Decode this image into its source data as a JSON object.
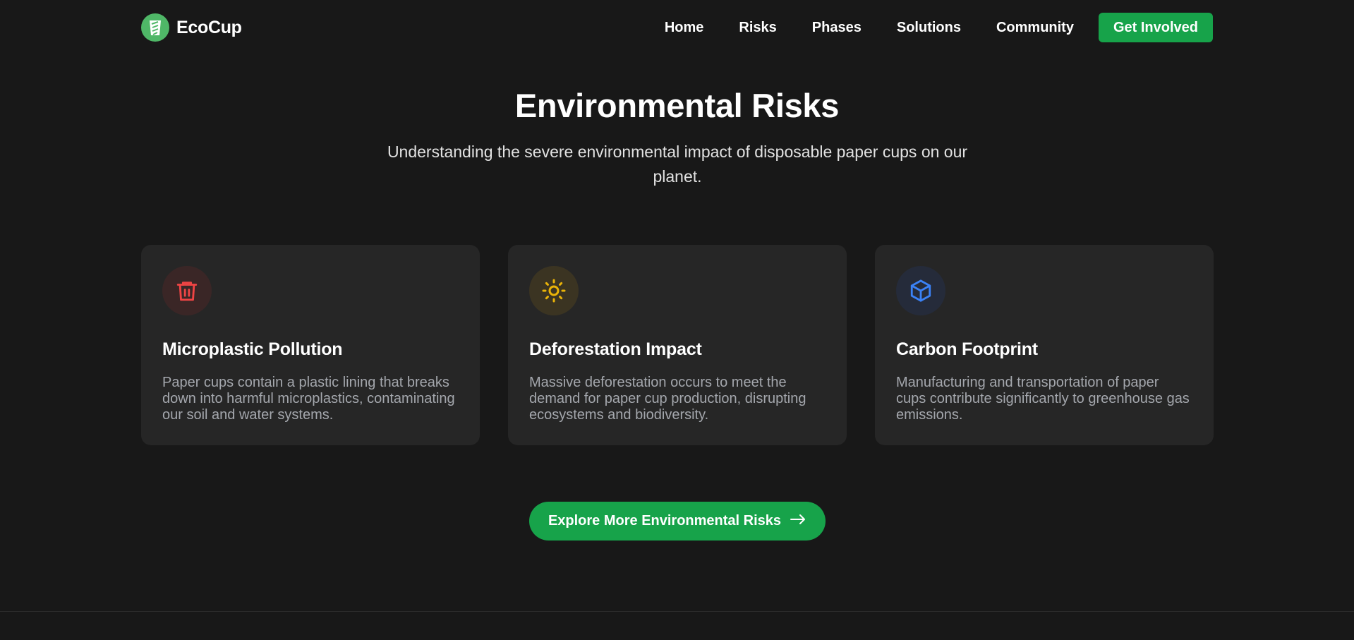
{
  "brand": {
    "name": "EcoCup",
    "logo_icon": "cup-icon"
  },
  "nav": {
    "items": [
      {
        "label": "Home"
      },
      {
        "label": "Risks"
      },
      {
        "label": "Phases"
      },
      {
        "label": "Solutions"
      },
      {
        "label": "Community"
      }
    ],
    "cta_label": "Get Involved"
  },
  "hero": {
    "title": "Environmental Risks",
    "subtitle": "Understanding the severe environmental impact of disposable paper cups on our planet."
  },
  "cards": [
    {
      "icon": "trash-icon",
      "icon_color": "#ef4444",
      "icon_bg": "#3a2626",
      "title": "Microplastic Pollution",
      "text": "Paper cups contain a plastic lining that breaks down into harmful microplastics, contaminating our soil and water systems."
    },
    {
      "icon": "sun-icon",
      "icon_color": "#eab308",
      "icon_bg": "#3b3422",
      "title": "Deforestation Impact",
      "text": "Massive deforestation occurs to meet the demand for paper cup production, disrupting ecosystems and biodiversity."
    },
    {
      "icon": "cube-icon",
      "icon_color": "#3b82f6",
      "icon_bg": "#252b3a",
      "title": "Carbon Footprint",
      "text": "Manufacturing and transportation of paper cups contribute significantly to greenhouse gas emissions."
    }
  ],
  "explore": {
    "label": "Explore More Environmental Risks",
    "icon": "arrow-right-icon"
  },
  "colors": {
    "accent": "#17a34a",
    "background": "#181818",
    "card": "#262626"
  }
}
